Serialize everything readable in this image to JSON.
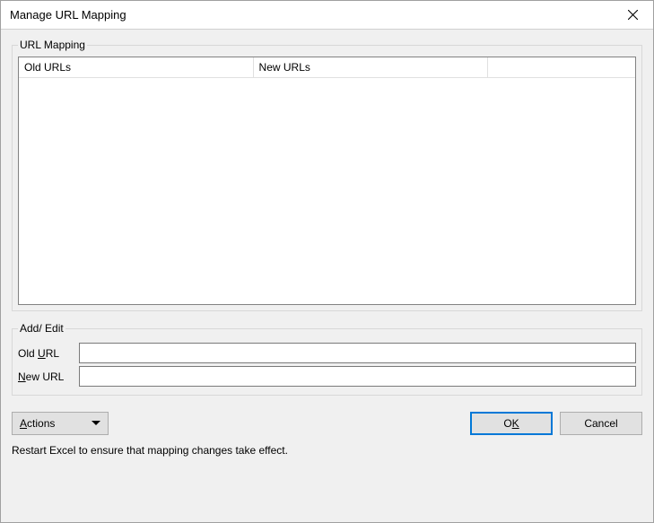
{
  "window": {
    "title": "Manage URL Mapping"
  },
  "groups": {
    "mapping_legend": "URL Mapping",
    "addedit_legend": "Add/ Edit"
  },
  "table": {
    "col_old": "Old URLs",
    "col_new": "New URLs",
    "rows": []
  },
  "form": {
    "old_url_label_pre": "Old ",
    "old_url_label_u": "U",
    "old_url_label_post": "RL",
    "old_url_value": "",
    "new_url_label_u": "N",
    "new_url_label_post": "ew URL",
    "new_url_value": ""
  },
  "buttons": {
    "actions_u": "A",
    "actions_post": "ctions",
    "ok_pre": "O",
    "ok_u": "K",
    "cancel": "Cancel"
  },
  "status": "Restart Excel to ensure that mapping changes take effect."
}
